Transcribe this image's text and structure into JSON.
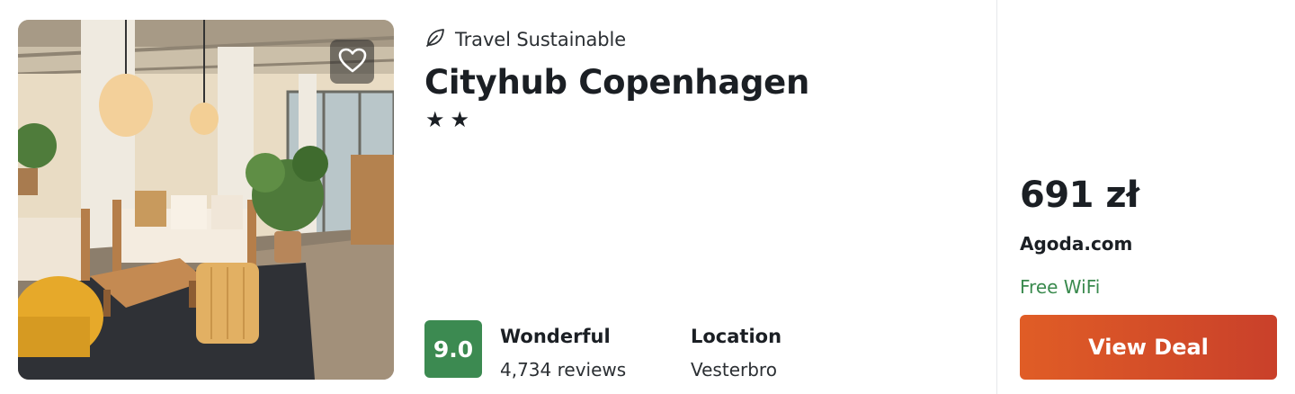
{
  "hotel": {
    "sustainability_label": "Travel Sustainable",
    "name": "Cityhub Copenhagen",
    "stars_display": "★★",
    "star_count": 2
  },
  "rating": {
    "score": "9.0",
    "label": "Wonderful",
    "reviews": "4,734 reviews"
  },
  "location": {
    "title": "Location",
    "area": "Vesterbro"
  },
  "deal": {
    "price": "691 zł",
    "provider": "Agoda.com",
    "amenity": "Free WiFi",
    "button_label": "View Deal"
  },
  "colors": {
    "score_badge": "#3c8a51",
    "amenity_text": "#3a8a4e",
    "deal_button_start": "#e05d26",
    "deal_button_end": "#c9402a"
  },
  "icons": {
    "favorite": "heart-icon",
    "sustainable": "leaf-icon"
  }
}
